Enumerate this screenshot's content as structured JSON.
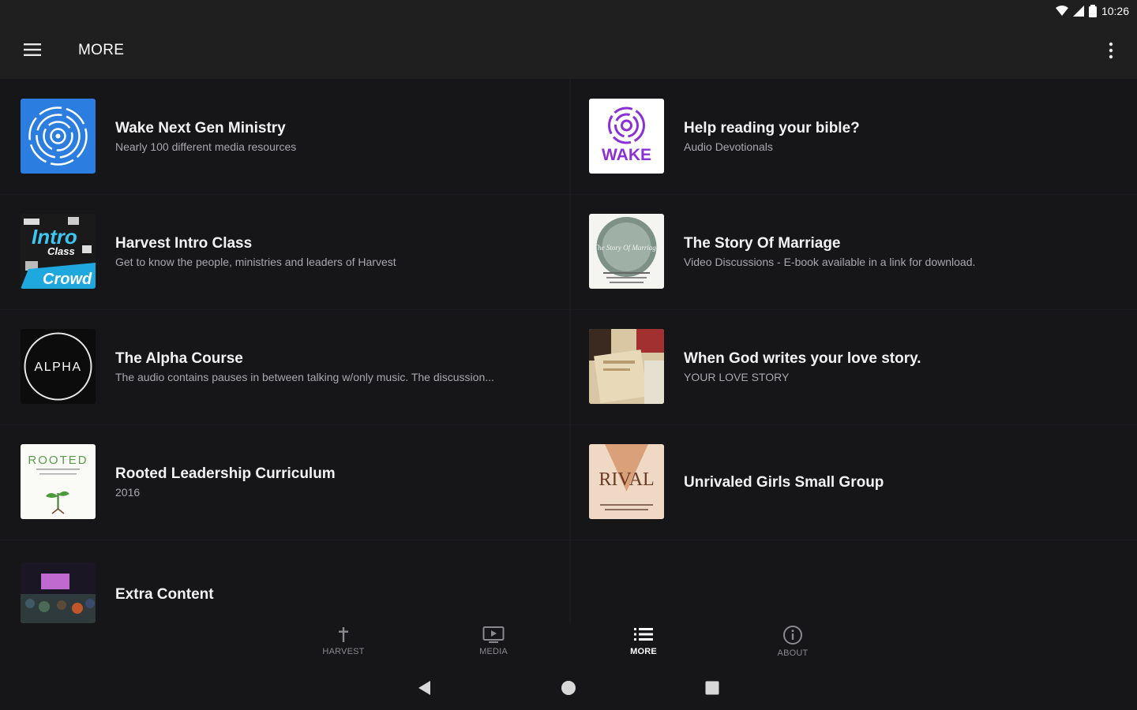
{
  "status_bar": {
    "time": "10:26"
  },
  "app_bar": {
    "title": "MORE"
  },
  "colors": {
    "background": "#161619",
    "bar": "#1f1f20",
    "subtitle": "#a9a9ad",
    "nav_inactive": "#8a8a8e",
    "nav_active": "#ffffff"
  },
  "items": [
    {
      "title": "Wake Next Gen Ministry",
      "subtitle": "Nearly 100 different media resources"
    },
    {
      "title": "Help reading your bible?",
      "subtitle": "Audio Devotionals"
    },
    {
      "title": "Harvest Intro Class",
      "subtitle": "Get to know the people, ministries and leaders of Harvest"
    },
    {
      "title": "The Story Of Marriage",
      "subtitle": "Video Discussions - E-book available in a link for download."
    },
    {
      "title": "The Alpha Course",
      "subtitle": "The audio contains  pauses in between talking w/only music. The discussion..."
    },
    {
      "title": "When God writes your love story.",
      "subtitle": "YOUR LOVE STORY"
    },
    {
      "title": "Rooted Leadership Curriculum",
      "subtitle": "2016"
    },
    {
      "title": "Unrivaled Girls Small Group",
      "subtitle": ""
    },
    {
      "title": "Extra Content",
      "subtitle": ""
    }
  ],
  "thumbnails": {
    "wake_logo_text": "WAKE",
    "intro_line1": "Intro",
    "intro_line2": "Class",
    "intro_line3": "Crowd",
    "alpha": "ALPHA",
    "rooted": "ROOTED",
    "marriage": "The Story Of Marriage",
    "rival": "RIVAL"
  },
  "bottom_nav": {
    "tabs": [
      {
        "label": "HARVEST",
        "icon": "cross-icon",
        "active": false
      },
      {
        "label": "MEDIA",
        "icon": "media-icon",
        "active": false
      },
      {
        "label": "MORE",
        "icon": "list-icon",
        "active": true
      },
      {
        "label": "ABOUT",
        "icon": "info-icon",
        "active": false
      }
    ]
  }
}
